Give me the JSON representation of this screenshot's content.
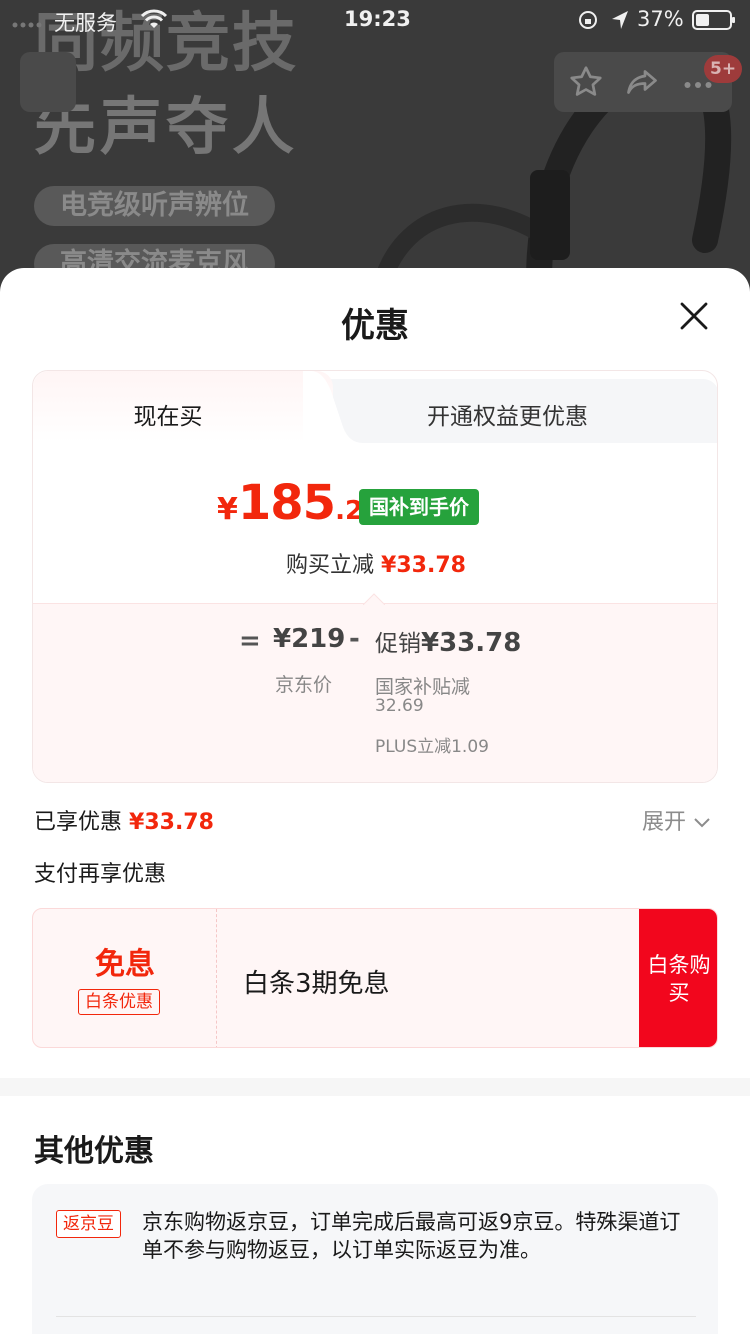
{
  "status_bar": {
    "carrier": "无服务",
    "time": "19:23",
    "battery": "37%"
  },
  "background": {
    "hero_line1": "同频竞技",
    "hero_line2": "先声夺人",
    "pill1": "电竞级听声辨位",
    "pill2": "高清交流麦克风",
    "cart_badge": "5+"
  },
  "sheet": {
    "title": "优惠",
    "tabs": [
      "现在买",
      "开通权益更优惠"
    ],
    "price": {
      "yen": "¥",
      "integer": "185",
      "decimal": ".22",
      "tag": "国补到手价"
    },
    "save_line": {
      "label": "购买立减",
      "value": "¥33.78"
    },
    "breakdown": {
      "equals": "=",
      "jd_price": "¥219",
      "jd_label": "京东价",
      "minus": "-",
      "promo_label": "促销",
      "promo_value": "¥33.78",
      "sub1_label": "国家补贴减",
      "sub1_value": "32.69",
      "sub2": "PLUS立减1.09"
    },
    "enjoyed": {
      "label": "已享优惠",
      "value": "¥33.78"
    },
    "expand_label": "展开",
    "pay_title": "支付再享优惠",
    "baitiao": {
      "main": "免息",
      "tag": "白条优惠",
      "desc": "白条3期免息",
      "button": "白条购买"
    },
    "other": {
      "title": "其他优惠",
      "tag": "返京豆",
      "text": "京东购物返京豆，订单完成后最高可返9京豆。特殊渠道订单不参与购物返豆，以订单实际返豆为准。"
    }
  },
  "colors": {
    "accent_red": "#f2270c",
    "button_red": "#f2061d",
    "subsidy_green": "#26a23c"
  }
}
